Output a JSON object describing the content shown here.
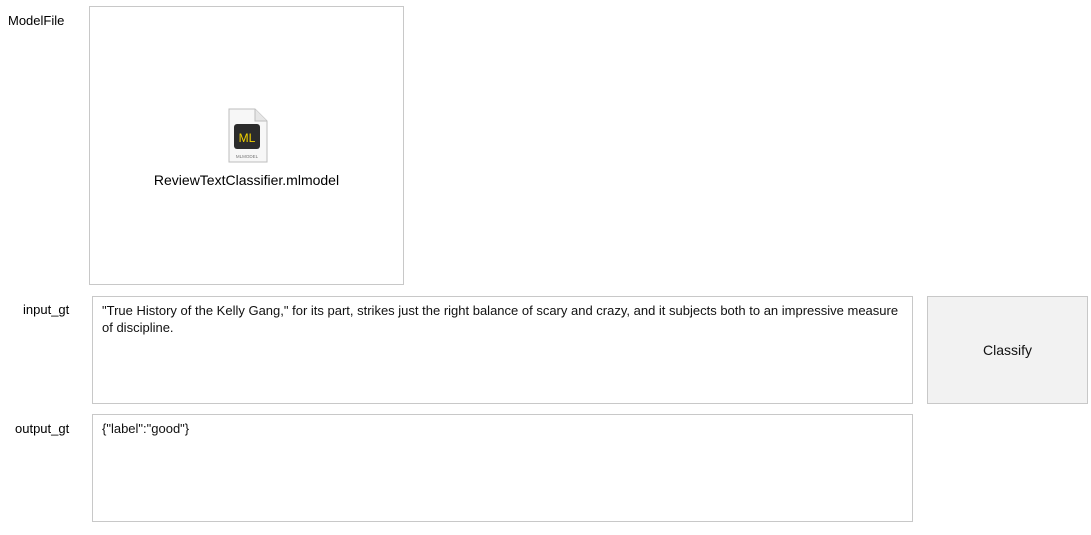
{
  "model_file": {
    "label": "ModelFile",
    "file_name": "ReviewTextClassifier.mlmodel",
    "icon": "mlmodel-file-icon",
    "icon_badge": "ML",
    "icon_caption": "MLMODEL"
  },
  "input": {
    "label": "input_gt",
    "value": "\"True History of the Kelly Gang,\" for its part, strikes just the right balance of scary and crazy, and it subjects both to an impressive measure of discipline."
  },
  "classify_button": {
    "label": "Classify"
  },
  "output": {
    "label": "output_gt",
    "value": "{\"label\":\"good\"}"
  },
  "colors": {
    "border": "#c8c8c8",
    "button_bg": "#f2f2f2",
    "icon_badge_bg": "#2b2b2b",
    "icon_badge_text": "#f2d200"
  }
}
